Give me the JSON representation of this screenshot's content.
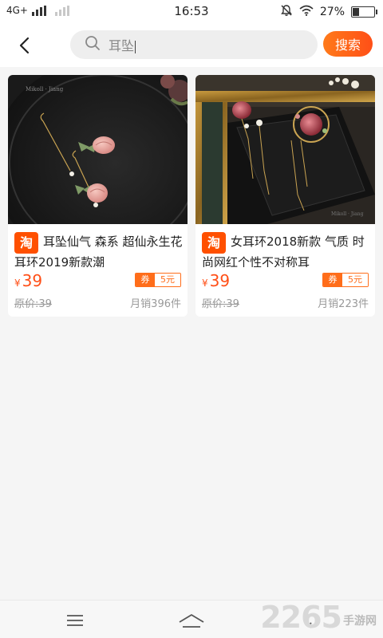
{
  "status_bar": {
    "network": "4G+",
    "time": "16:53",
    "battery": "27%",
    "battery_level": 0.27,
    "icons": [
      "signal-icon",
      "mute-icon",
      "wifi-icon",
      "battery-icon"
    ]
  },
  "header": {
    "back_icon": "chevron-left-icon",
    "search_icon": "search-icon",
    "search_value": "耳坠",
    "search_button": "搜索"
  },
  "products": [
    {
      "platform_badge": "淘",
      "title": "耳坠仙气 森系 超仙永生花耳环2019新款潮",
      "currency": "¥",
      "price": "39",
      "coupon_label": "券",
      "coupon_value": "5元",
      "original_price": "原价:39",
      "monthly_sales": "月销396件"
    },
    {
      "platform_badge": "淘",
      "title": "女耳环2018新款 气质 时尚网红个性不对称耳",
      "currency": "¥",
      "price": "39",
      "coupon_label": "券",
      "coupon_value": "5元",
      "original_price": "原价:39",
      "monthly_sales": "月销223件"
    }
  ],
  "nav_bar": {
    "icons": [
      "menu-icon",
      "home-icon",
      "back-icon"
    ]
  },
  "watermark": {
    "brand": "2265",
    "suffix": "手游网"
  }
}
